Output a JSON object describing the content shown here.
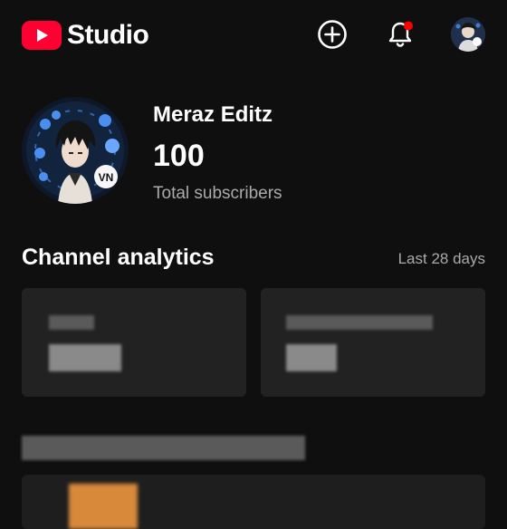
{
  "header": {
    "logo_text": "Studio",
    "icons": [
      "create-icon",
      "notifications-icon",
      "account-avatar"
    ],
    "notification_dot_color": "#ff0000"
  },
  "channel": {
    "name": "Meraz Editz",
    "subscriber_count": "100",
    "subscriber_label": "Total subscribers"
  },
  "analytics": {
    "title": "Channel analytics",
    "period": "Last 28 days"
  },
  "colors": {
    "background": "#0f0f0f",
    "brand_red": "#ff0033",
    "card": "#222222",
    "secondary_text": "#aaaaaa"
  }
}
